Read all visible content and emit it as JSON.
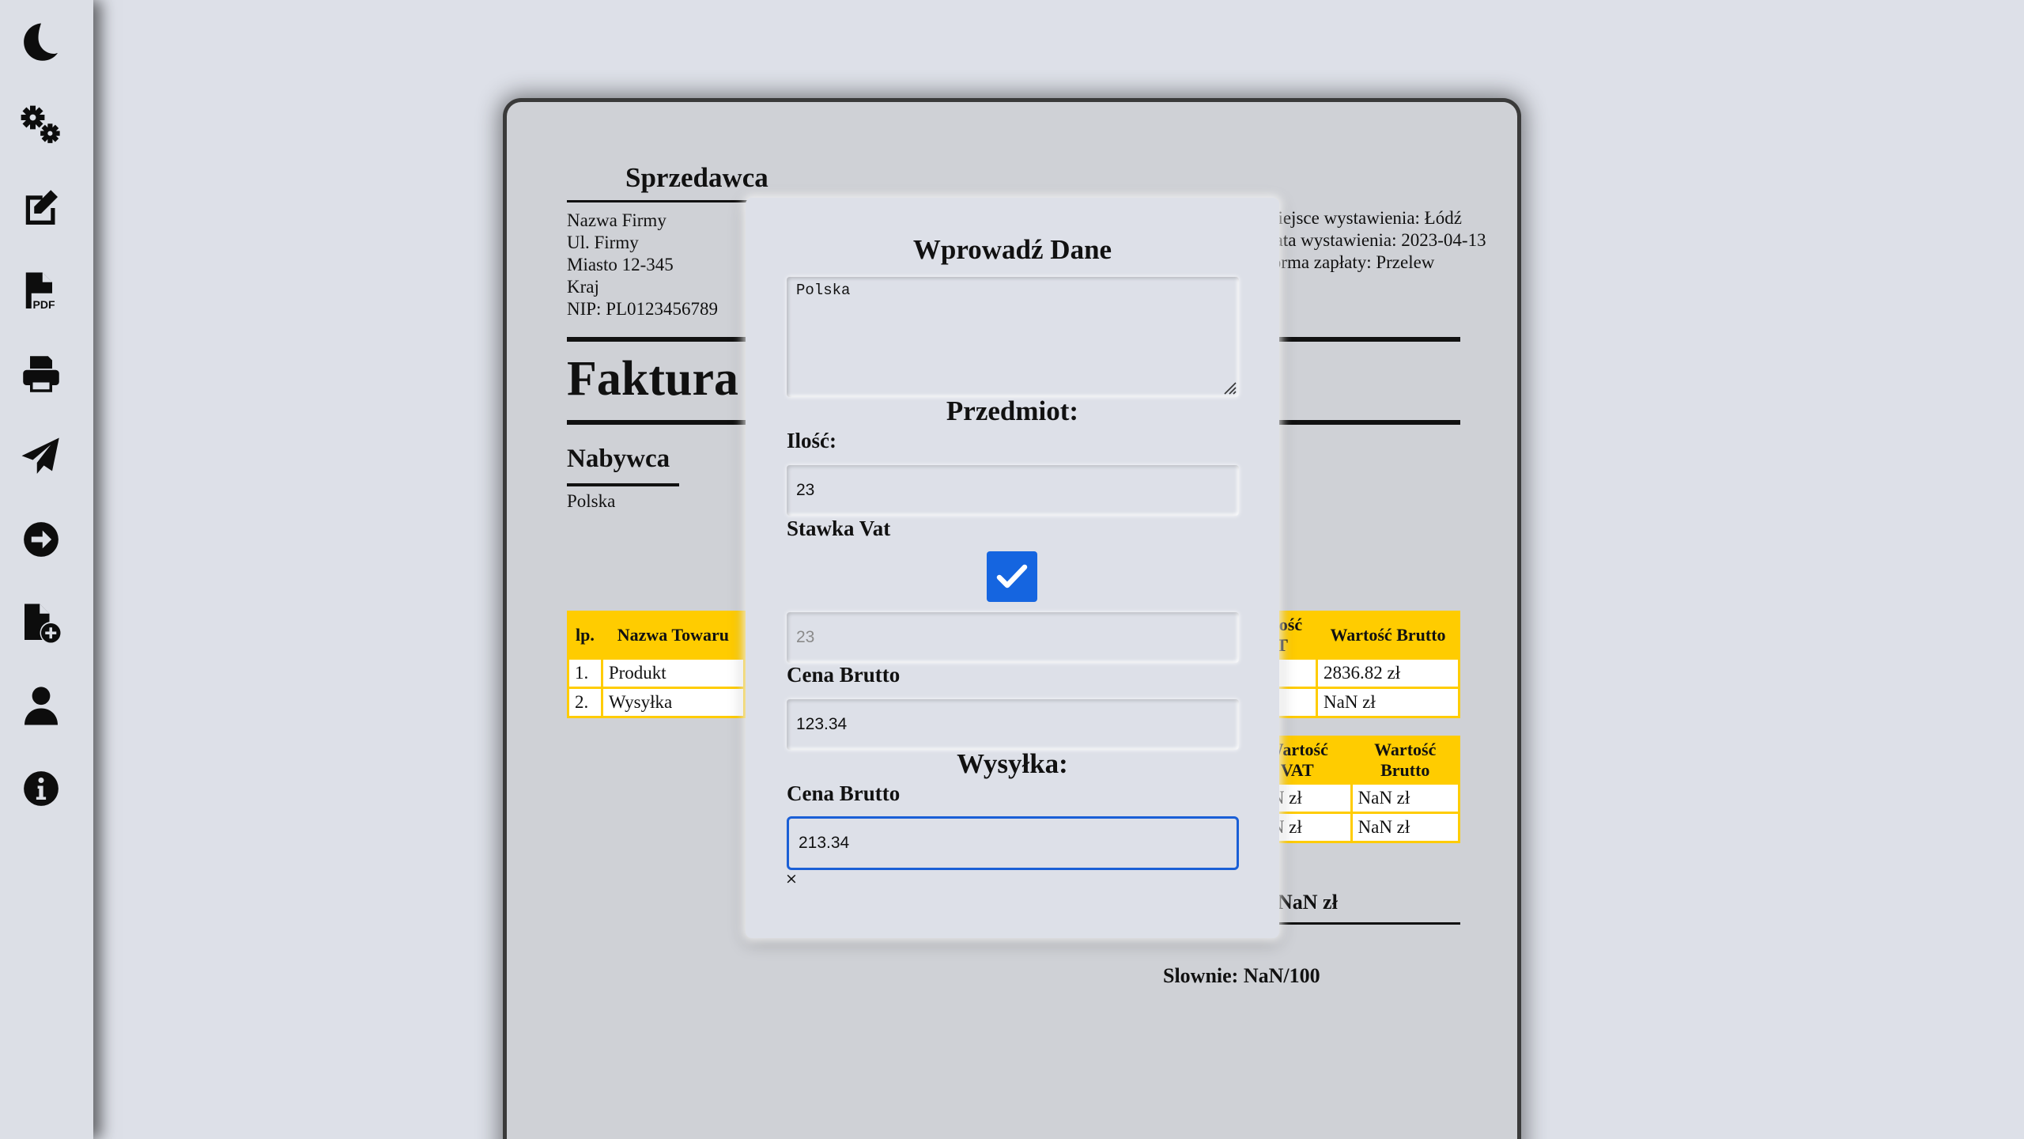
{
  "sidebar": {
    "items": [
      {
        "name": "theme-toggle-button",
        "icon": "moon-icon"
      },
      {
        "name": "settings-button",
        "icon": "gears-icon"
      },
      {
        "name": "edit-button",
        "icon": "edit-icon"
      },
      {
        "name": "pdf-button",
        "icon": "file-pdf-icon"
      },
      {
        "name": "print-button",
        "icon": "print-icon"
      },
      {
        "name": "send-button",
        "icon": "paper-plane-icon"
      },
      {
        "name": "next-button",
        "icon": "arrow-right-circle-icon"
      },
      {
        "name": "new-invoice-button",
        "icon": "file-plus-icon"
      },
      {
        "name": "user-button",
        "icon": "user-icon"
      },
      {
        "name": "info-button",
        "icon": "info-circle-icon"
      }
    ]
  },
  "invoice": {
    "seller_title": "Sprzedawca",
    "seller": {
      "name": "Nazwa Firmy",
      "street": "Ul. Firmy",
      "city": "Miasto 12-345",
      "country": "Kraj",
      "nip": "NIP: PL0123456789"
    },
    "meta": {
      "place": "Miejsce wystawienia: Łódź",
      "date": "Data wystawienia: 2023-04-13",
      "payment": "Forma zapłaty: Przelew"
    },
    "title": "Faktura",
    "buyer_title": "Nabywca",
    "buyer_country": "Polska",
    "items_table": {
      "headers": [
        "lp.",
        "Nazwa Towaru",
        "Wartość VAT",
        "Wartość Brutto"
      ],
      "rows": [
        [
          "1.",
          "Produkt",
          "",
          "2836.82 zł"
        ],
        [
          "2.",
          "Wysyłka",
          "",
          "NaN zł"
        ]
      ]
    },
    "summary_table": {
      "headers": [
        "Wartość VAT",
        "Wartość Brutto"
      ],
      "rows": [
        [
          "NaN zł",
          "NaN zł"
        ],
        [
          "NaN zł",
          "NaN zł"
        ]
      ]
    },
    "total": "NaN zł",
    "in_words": "Slownie: NaN/100"
  },
  "modal": {
    "title": "Wprowadź Dane",
    "address_value": "Polska",
    "subject_title": "Przedmiot:",
    "quantity_label": "Ilość:",
    "quantity_value": "23",
    "vat_label": "Stawka Vat",
    "vat_checked": true,
    "vat_value": "23",
    "price_label": "Cena Brutto",
    "price_value": "123.34",
    "shipping_title": "Wysyłka:",
    "shipping_price_label": "Cena Brutto",
    "shipping_price_value": "213.34",
    "close_label": "×",
    "accent_color": "#1565e0"
  }
}
